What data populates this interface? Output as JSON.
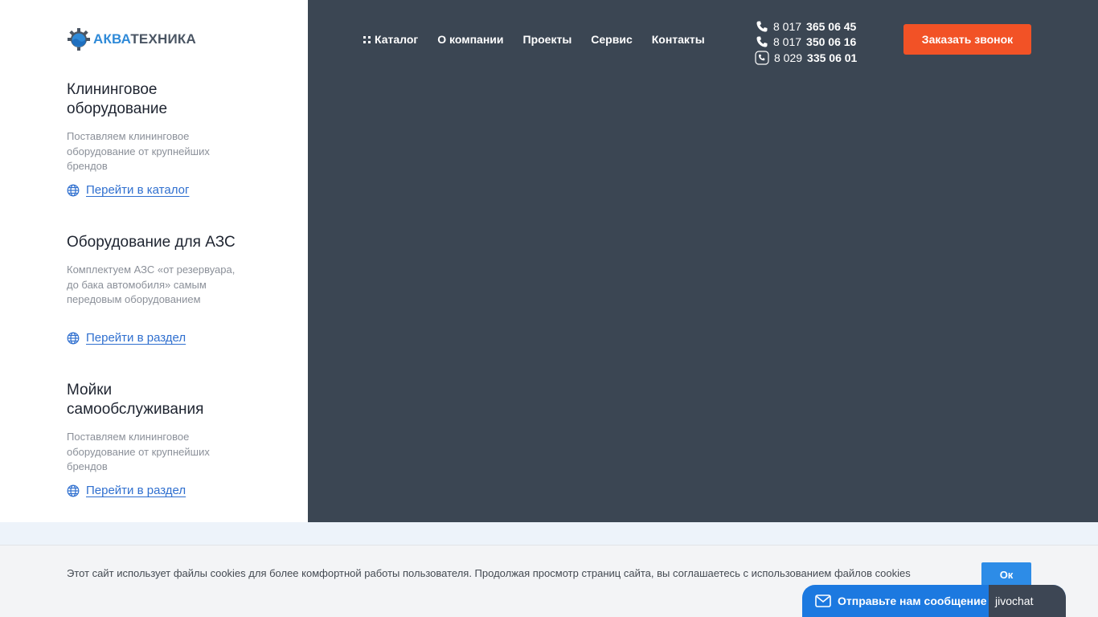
{
  "logo": {
    "part_a": "АКВА",
    "part_b": "ТЕХНИКА"
  },
  "nav": [
    {
      "label": "Каталог",
      "icon": "grid-dots-icon"
    },
    {
      "label": "О компании"
    },
    {
      "label": "Проекты"
    },
    {
      "label": "Сервис"
    },
    {
      "label": "Контакты"
    }
  ],
  "phones": [
    {
      "prefix": "8 017",
      "number": "365 06 45",
      "icon": "phone-icon"
    },
    {
      "prefix": "8 017",
      "number": "350 06 16",
      "icon": "phone-icon"
    },
    {
      "prefix": "8 029",
      "number": "335 06 01",
      "icon": "viber-icon"
    }
  ],
  "cta_label": "Заказать звонок",
  "sections": [
    {
      "title": "Клининговое оборудование",
      "description": "Поставляем клининговое оборудование от крупнейших брендов",
      "link": "Перейти в каталог"
    },
    {
      "title": "Оборудование для АЗС",
      "description": "Комплектуем АЗС «от резервуара, до бака автомобиля» самым передовым оборудованием",
      "link": "Перейти в раздел"
    },
    {
      "title": "Мойки самообслуживания",
      "description": "Поставляем клининговое оборудование от крупнейших брендов",
      "link": "Перейти в раздел"
    }
  ],
  "cookie": {
    "text": "Этот сайт использует файлы cookies для более комфортной работы пользователя. Продолжая просмотр страниц сайта, вы соглашаетесь с использованием файлов cookies",
    "ok": "Ок"
  },
  "chat": {
    "label": "Отправьте нам сообщение",
    "brand": "jivochat"
  },
  "colors": {
    "hero_bg": "#3b4653",
    "accent_orange": "#f25226",
    "link_blue": "#2f6fcf",
    "ok_blue": "#2d8ce7",
    "chat_blue": "#1c79e0"
  }
}
